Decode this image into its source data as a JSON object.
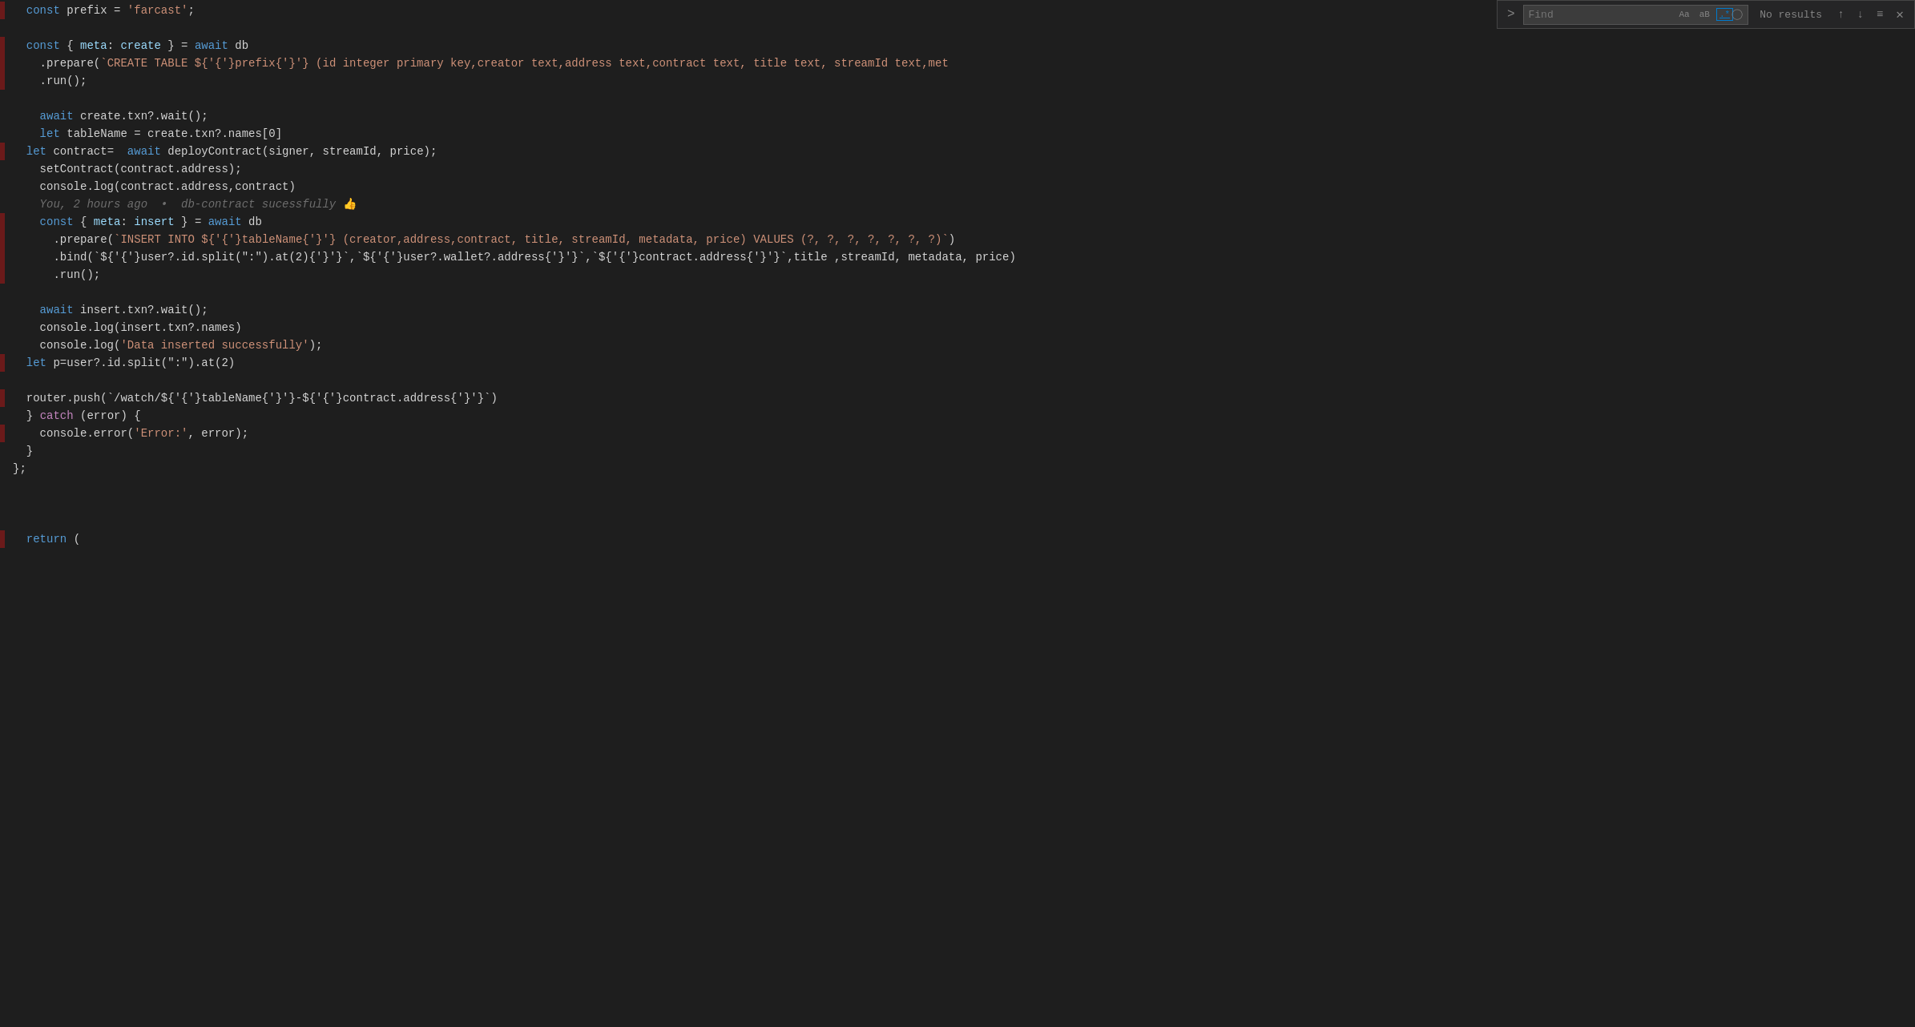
{
  "editor": {
    "background": "#1e1e1e",
    "theme": "dark"
  },
  "find_widget": {
    "arrow_label": ">",
    "input_placeholder": "Find",
    "input_value": "",
    "option_match_case": "Aa",
    "option_whole_word": "aB",
    "option_regex": ".*",
    "no_results_label": "No results",
    "nav_up_label": "↑",
    "nav_down_label": "↓",
    "more_options_label": "≡",
    "close_label": "✕"
  },
  "code": {
    "lines": [
      {
        "num": "",
        "diff": "red",
        "content_html": "  <span class='kw'>const</span> <span class='plain'>prefix = </span><span class='str'>'farcast'</span><span class='plain'>;</span>"
      },
      {
        "num": "",
        "diff": "empty",
        "content_html": ""
      },
      {
        "num": "",
        "diff": "red",
        "content_html": "  <span class='kw'>const</span> <span class='plain'>{ </span><span class='lightblue'>meta</span><span class='plain'>: </span><span class='lightblue'>create</span><span class='plain'> } = </span><span class='kw'>await</span><span class='plain'> db</span>"
      },
      {
        "num": "",
        "diff": "red",
        "content_html": "    <span class='plain'>.prepare(</span><span class='str'>`CREATE TABLE ${prefix} (id integer primary key,creator text,address text,contract text, title text, streamId text,met</span>"
      },
      {
        "num": "",
        "diff": "red",
        "content_html": "    <span class='plain'>.run();</span>"
      },
      {
        "num": "",
        "diff": "empty",
        "content_html": ""
      },
      {
        "num": "",
        "diff": "empty",
        "content_html": "    <span class='kw'>await</span><span class='plain'> create.txn?.wait();</span>"
      },
      {
        "num": "",
        "diff": "empty",
        "content_html": "    <span class='kw'>let</span><span class='plain'> tableName = create.txn?.names[0]</span>"
      },
      {
        "num": "",
        "diff": "red",
        "content_html": "  <span class='kw'>let</span><span class='plain'> contract=  </span><span class='kw'>await</span><span class='plain'> deployContract(signer, streamId, price);</span>"
      },
      {
        "num": "",
        "diff": "empty",
        "content_html": "    <span class='plain'>setContract(contract.address);</span>"
      },
      {
        "num": "",
        "diff": "empty",
        "content_html": "    <span class='plain'>console.log(contract.address,contract)</span>"
      },
      {
        "num": "",
        "diff": "empty",
        "content_html": "    <span class='inline-hint'>You, 2 hours ago  •  db-contract sucessfully </span><span class='emoji'>👍</span>"
      },
      {
        "num": "",
        "diff": "red",
        "content_html": "    <span class='kw'>const</span><span class='plain'> { </span><span class='lightblue'>meta</span><span class='plain'>: </span><span class='lightblue'>insert</span><span class='plain'> } = </span><span class='kw'>await</span><span class='plain'> db</span>"
      },
      {
        "num": "",
        "diff": "red",
        "content_html": "      <span class='plain'>.prepare(</span><span class='str'>`INSERT INTO ${tableName} (creator,address,contract, title, streamId, metadata, price) VALUES (?, ?, ?, ?, ?, ?, ?)`</span><span class='plain'>)</span>"
      },
      {
        "num": "",
        "diff": "red",
        "content_html": "      <span class='plain'>.bind(</span><span class='str'>`${user?.id.split(\":\").at(2)}`</span><span class='plain'>,</span><span class='str'>`${user?.wallet?.address}`</span><span class='plain'>,</span><span class='str'>`${contract.address}`</span><span class='plain'>,title ,streamId, metadata, price)</span>"
      },
      {
        "num": "",
        "diff": "red",
        "content_html": "      <span class='plain'>.run();</span>"
      },
      {
        "num": "",
        "diff": "empty",
        "content_html": ""
      },
      {
        "num": "",
        "diff": "empty",
        "content_html": "    <span class='kw'>await</span><span class='plain'> insert.txn?.wait();</span>"
      },
      {
        "num": "",
        "diff": "empty",
        "content_html": "    <span class='plain'>console.log(insert.txn?.names)</span>"
      },
      {
        "num": "",
        "diff": "empty",
        "content_html": "    <span class='plain'>console.log(</span><span class='str'>'Data inserted successfully'</span><span class='plain'>);</span>"
      },
      {
        "num": "",
        "diff": "red",
        "content_html": "  <span class='kw'>let</span><span class='plain'> p=user?.id.split(\":\").at(2)</span>"
      },
      {
        "num": "",
        "diff": "empty",
        "content_html": ""
      },
      {
        "num": "",
        "diff": "red",
        "content_html": "  <span class='plain'>router.push(</span><span class='str'>`/watch/${tableName}-${contract.address}`</span><span class='plain'>)</span>"
      },
      {
        "num": "",
        "diff": "empty",
        "content_html": "  <span class='plain'>} </span><span class='kw2'>catch</span><span class='plain'> (error) {</span>"
      },
      {
        "num": "",
        "diff": "red",
        "content_html": "    <span class='plain'>console.error(</span><span class='str'>'Error:'</span><span class='plain'>, error);</span>"
      },
      {
        "num": "",
        "diff": "empty",
        "content_html": "  <span class='plain'>}</span>"
      },
      {
        "num": "",
        "diff": "empty",
        "content_html": "<span class='plain'>};</span>"
      },
      {
        "num": "",
        "diff": "empty",
        "content_html": ""
      },
      {
        "num": "",
        "diff": "empty",
        "content_html": ""
      },
      {
        "num": "",
        "diff": "empty",
        "content_html": ""
      },
      {
        "num": "",
        "diff": "red",
        "content_html": "  <span class='kw'>return</span><span class='plain'> (</span>"
      }
    ]
  }
}
